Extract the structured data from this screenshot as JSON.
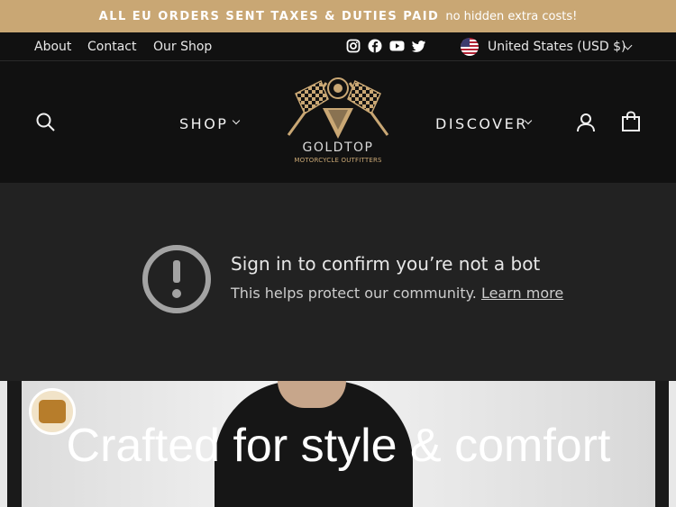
{
  "announcement": {
    "bold": "ALL EU ORDERS SENT TAXES & DUTIES PAID",
    "rest": "no hidden extra costs!"
  },
  "utility_nav": {
    "about": "About",
    "contact": "Contact",
    "shop": "Our Shop",
    "currency": "United States (USD $)"
  },
  "main_nav": {
    "shop": "SHOP",
    "discover": "DISCOVER"
  },
  "logo": {
    "name": "GOLDTOP",
    "subtitle": "MOTORCYCLE OUTFITTERS"
  },
  "captcha": {
    "title": "Sign in to confirm you’re not a bot",
    "subtitle": "This helps protect our community.",
    "link": "Learn more"
  },
  "hero": {
    "title": "Crafted for style & comfort"
  },
  "icons": {
    "instagram": "instagram-icon",
    "facebook": "facebook-icon",
    "youtube": "youtube-icon",
    "twitter": "twitter-icon",
    "flag": "us-flag-icon",
    "search": "search-icon",
    "account": "account-icon",
    "cart": "cart-icon"
  },
  "colors": {
    "announcement": "#c9a774",
    "header": "#111111",
    "captcha_bg": "#222222",
    "gold": "#c9a774"
  }
}
